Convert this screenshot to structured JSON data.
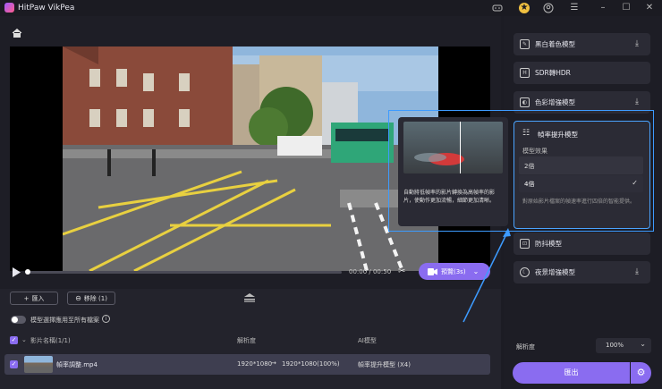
{
  "app": {
    "title": "HitPaw VikPea"
  },
  "player": {
    "time": "00:00 / 00:50",
    "preview_label": "預覽(3s)",
    "preview_chevron": "⌄"
  },
  "toolbar": {
    "import_label": "匯入",
    "remove_label": "移除 (1)",
    "apply_all_label": "模型選擇應用至所有檔案"
  },
  "table": {
    "headers": {
      "name": "影片名稱(1/1)",
      "resolution": "解析度",
      "model": "AI模型"
    },
    "rows": [
      {
        "name": "幀率調整.mp4",
        "res_from": "1920*1080",
        "res_arrow": "→",
        "res_to": "1920*1080(100%)",
        "model": "幀率提升模型 (X4)"
      }
    ]
  },
  "models": {
    "bw": "黑白着色模型",
    "sdr": "SDR轉HDR",
    "color": "色彩增強模型",
    "frame": "幀率提升模型",
    "frame_effect_label": "模型效果",
    "options": [
      "2倍",
      "4倍"
    ],
    "selected_option": "4倍",
    "frame_desc": "對原始影片檔案的幀速率進行四倍的智能提供。",
    "stabilize": "防抖模型",
    "night": "夜景增強模型"
  },
  "popup": {
    "desc": "自動將低幀率的影片轉換為高幀率的影片，使動作更加流暢，細節更加清晰。"
  },
  "export": {
    "resolution_label": "解析度",
    "resolution_value": "100%",
    "export_label": "匯出"
  },
  "colors": {
    "accent": "#8a6cf0",
    "blue": "#3d9bff"
  }
}
